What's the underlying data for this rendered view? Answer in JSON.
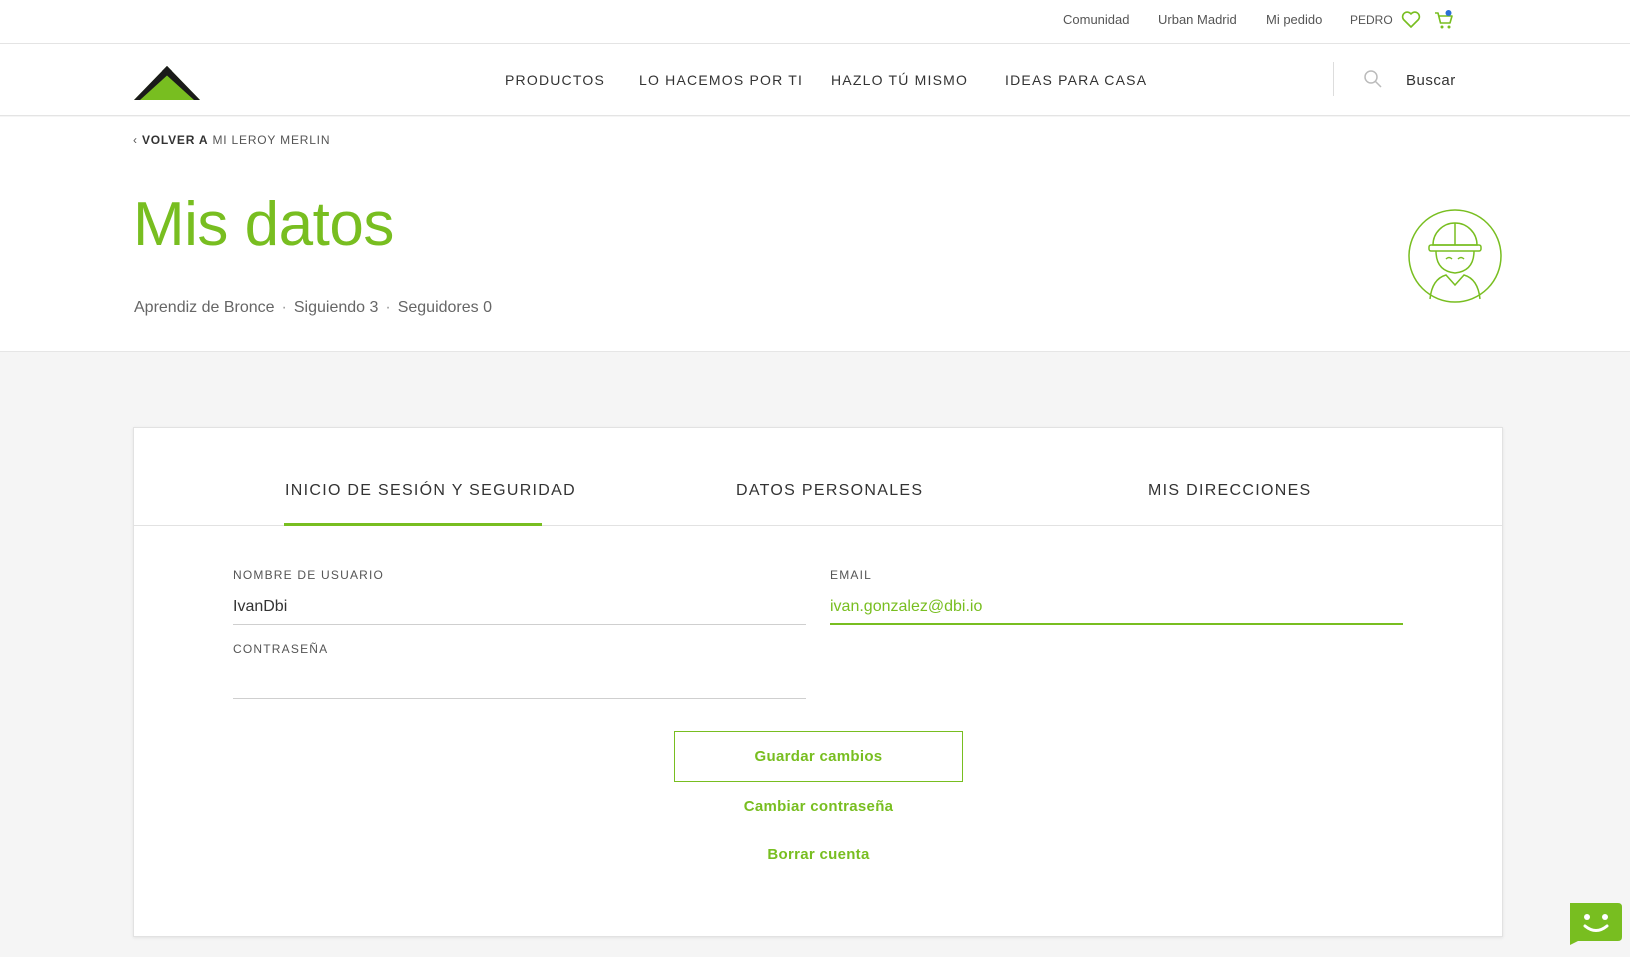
{
  "topbar": {
    "links": [
      "Comunidad",
      "Urban Madrid",
      "Mi pedido"
    ],
    "user": "PEDRO",
    "icons": [
      "heart-icon",
      "cart-icon"
    ]
  },
  "nav": {
    "logo_text": "LEROY MERLIN",
    "items": [
      "PRODUCTOS",
      "LO HACEMOS POR TI",
      "HAZLO TÚ MISMO",
      "IDEAS PARA CASA"
    ],
    "search_label": "Buscar"
  },
  "header": {
    "back_prefix": "VOLVER A",
    "back_target": "MI LEROY MERLIN",
    "title": "Mis datos",
    "stats": [
      "Aprendiz de Bronce",
      "Siguiendo 3",
      "Seguidores 0"
    ]
  },
  "tabs": {
    "items": [
      "INICIO DE SESIÓN Y SEGURIDAD",
      "DATOS PERSONALES",
      "MIS DIRECCIONES"
    ],
    "active": 0
  },
  "form": {
    "username_label": "NOMBRE DE USUARIO",
    "username_value": "IvanDbi",
    "email_label": "EMAIL",
    "email_value": "ivan.gonzalez@dbi.io",
    "password_label": "CONTRASEÑA",
    "password_value": ""
  },
  "actions": {
    "save": "Guardar cambios",
    "change_password": "Cambiar contraseña",
    "delete_account": "Borrar cuenta"
  },
  "colors": {
    "brand_green": "#78be20",
    "text": "#333333",
    "background": "#f5f5f5"
  }
}
